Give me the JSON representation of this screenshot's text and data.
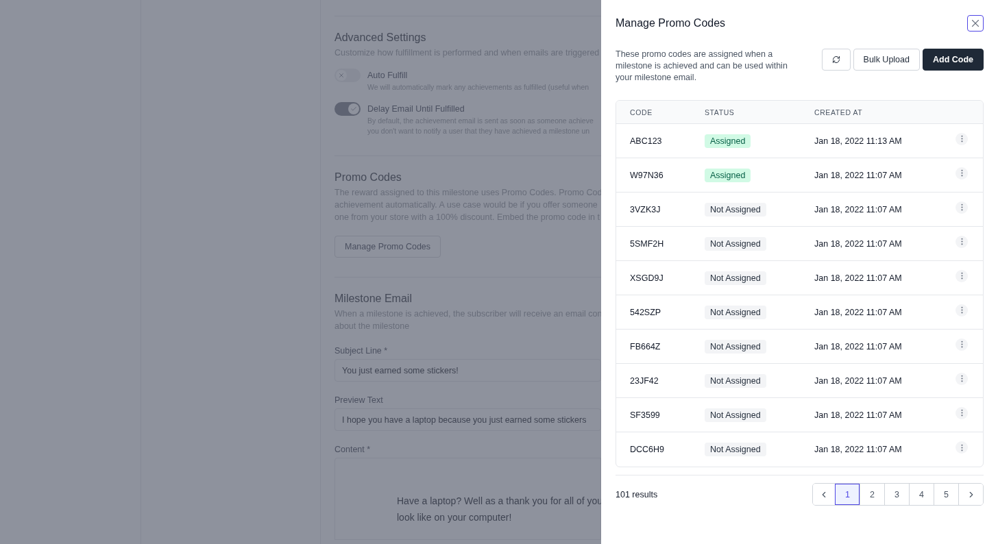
{
  "background_page": {
    "sections": [
      {
        "kind": "toggles",
        "title": "Advanced Settings",
        "description": [
          "Customize how fulfillment is performed and when emails are triggered"
        ],
        "toggles": [
          {
            "label": "Auto Fulfill",
            "on": false,
            "description": [
              "We will automatically mark any achievements as fulfilled (useful when"
            ]
          },
          {
            "label": "Delay Email Until Fulfilled",
            "on": true,
            "description": [
              "By default, the achievement email is sent as soon as someone achieve",
              "you don't want to notify a user that they have achieved a milestone un"
            ]
          }
        ]
      },
      {
        "kind": "button",
        "title": "Promo Codes",
        "description": [
          "The reward assigned to this milestone uses Promo Codes. Promo Cod",
          "achievement automatically. A use case would be if you offer someone",
          "one from your store with a 100% discount. Embed the promo code in t"
        ],
        "button": "Manage Promo Codes"
      },
      {
        "kind": "form",
        "title": "Milestone Email",
        "description": [
          "When a milestone is achieved, the subscriber will receive an email con",
          "about the milestone"
        ],
        "fields": [
          {
            "label": "Subject Line *",
            "value": "You just earned some stickers!"
          },
          {
            "label": "Preview Text",
            "value": "I hope you have a laptop because you just earned some stickers"
          }
        ],
        "content_label": "Content *",
        "content_lines": [
          "Have a laptop? Well as a thank you for all of you",
          "look like on your computer!"
        ]
      }
    ]
  },
  "panel": {
    "title": "Manage Promo Codes",
    "description": "These promo codes are assigned when a milestone is achieved and can be used within your milestone email.",
    "buttons": [
      {
        "label": "Bulk Upload",
        "kind": "secondary"
      },
      {
        "label": "Add Code",
        "kind": "primary"
      }
    ],
    "table": {
      "columns": [
        "CODE",
        "STATUS",
        "CREATED AT"
      ],
      "rows": [
        {
          "code": "ABC123",
          "status": "Assigned",
          "assigned": true,
          "created": "Jan 18, 2022 11:13 AM"
        },
        {
          "code": "W97N36",
          "status": "Assigned",
          "assigned": true,
          "created": "Jan 18, 2022 11:07 AM"
        },
        {
          "code": "3VZK3J",
          "status": "Not Assigned",
          "assigned": false,
          "created": "Jan 18, 2022 11:07 AM"
        },
        {
          "code": "5SMF2H",
          "status": "Not Assigned",
          "assigned": false,
          "created": "Jan 18, 2022 11:07 AM"
        },
        {
          "code": "XSGD9J",
          "status": "Not Assigned",
          "assigned": false,
          "created": "Jan 18, 2022 11:07 AM"
        },
        {
          "code": "542SZP",
          "status": "Not Assigned",
          "assigned": false,
          "created": "Jan 18, 2022 11:07 AM"
        },
        {
          "code": "FB664Z",
          "status": "Not Assigned",
          "assigned": false,
          "created": "Jan 18, 2022 11:07 AM"
        },
        {
          "code": "23JF42",
          "status": "Not Assigned",
          "assigned": false,
          "created": "Jan 18, 2022 11:07 AM"
        },
        {
          "code": "SF3599",
          "status": "Not Assigned",
          "assigned": false,
          "created": "Jan 18, 2022 11:07 AM"
        },
        {
          "code": "DCC6H9",
          "status": "Not Assigned",
          "assigned": false,
          "created": "Jan 18, 2022 11:07 AM"
        }
      ]
    },
    "results": "101 results",
    "pages": [
      {
        "label": "1",
        "selected": true
      },
      {
        "label": "2",
        "selected": false
      },
      {
        "label": "3",
        "selected": false
      },
      {
        "label": "4",
        "selected": false
      },
      {
        "label": "5",
        "selected": false
      }
    ]
  }
}
